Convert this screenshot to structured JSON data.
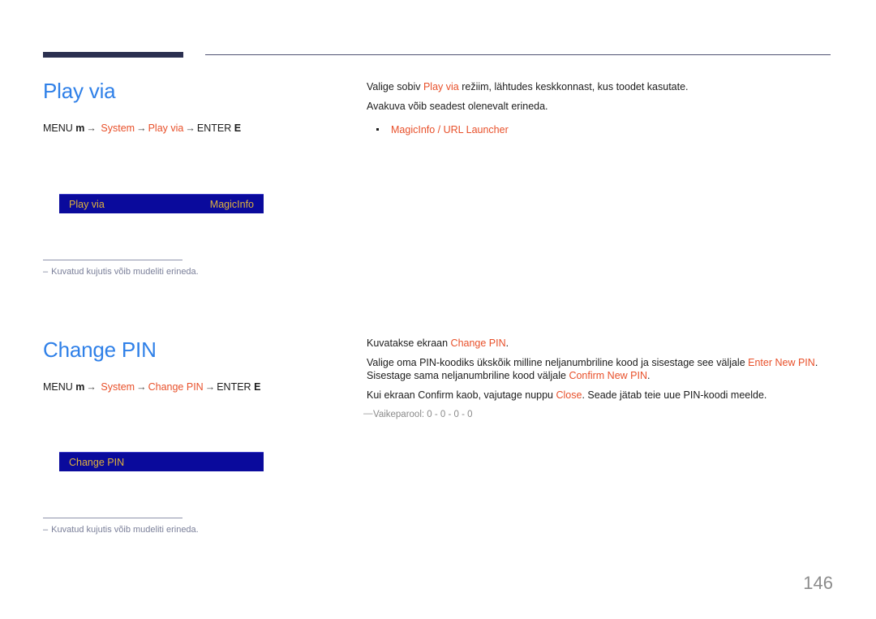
{
  "page": {
    "number": "146",
    "language": "et"
  },
  "sections": [
    {
      "id": "play-via",
      "title": "Play via",
      "menu_path": {
        "prefix": "MENU",
        "prefix_key": "m",
        "arrow": "→",
        "step1": "System",
        "step2": "Play via",
        "suffix": "ENTER",
        "suffix_key": "E"
      },
      "body": {
        "line1_pre": "Valige sobiv ",
        "line1_kw": "Play via",
        "line1_post": " režiim, lähtudes keskkonnast, kus toodet kasutate.",
        "line2": "Avakuva võib seadest olenevalt erineda.",
        "bullets": [
          "MagicInfo / URL Launcher"
        ]
      },
      "osd": {
        "label": "Play via",
        "value": "MagicInfo"
      },
      "footnote": "Kuvatud kujutis võib mudeliti erineda.",
      "footnote_dash": "–"
    },
    {
      "id": "change-pin",
      "title": "Change PIN",
      "menu_path": {
        "prefix": "MENU",
        "prefix_key": "m",
        "arrow": "→",
        "step1": "System",
        "step2": "Change PIN",
        "suffix": "ENTER",
        "suffix_key": "E"
      },
      "body": {
        "line1_pre": "Kuvatakse ekraan ",
        "line1_kw": "Change PIN",
        "line1_post": ".",
        "line2_pre": "Valige oma PIN-koodiks ükskõik milline neljanumbriline kood ja sisestage see väljale ",
        "line2_kw1": "Enter New PIN",
        "line2_mid": ". Sisestage sama neljanumbriline kood väljale ",
        "line2_kw2": "Confirm New PIN",
        "line2_post": ".",
        "line3_pre": "Kui ekraan Confirm kaob, vajutage nuppu ",
        "line3_kw": "Close",
        "line3_post": ". Seade jätab teie uue PIN-koodi meelde.",
        "subnote": "Vaikeparool: 0 - 0 - 0 - 0",
        "subnote_dash": "—"
      },
      "osd": {
        "label": "Change PIN",
        "value": ""
      },
      "footnote": "Kuvatud kujutis võib mudeliti erineda.",
      "footnote_dash": "–"
    }
  ],
  "colors": {
    "heading_blue": "#2f80e8",
    "accent_orange": "#e8502a",
    "osd_background": "#0a0a9c",
    "osd_text": "#e0b23c",
    "rule_navy": "#2b3050",
    "note_gray": "#7a7f99",
    "page_number_gray": "#8c8c8c"
  }
}
